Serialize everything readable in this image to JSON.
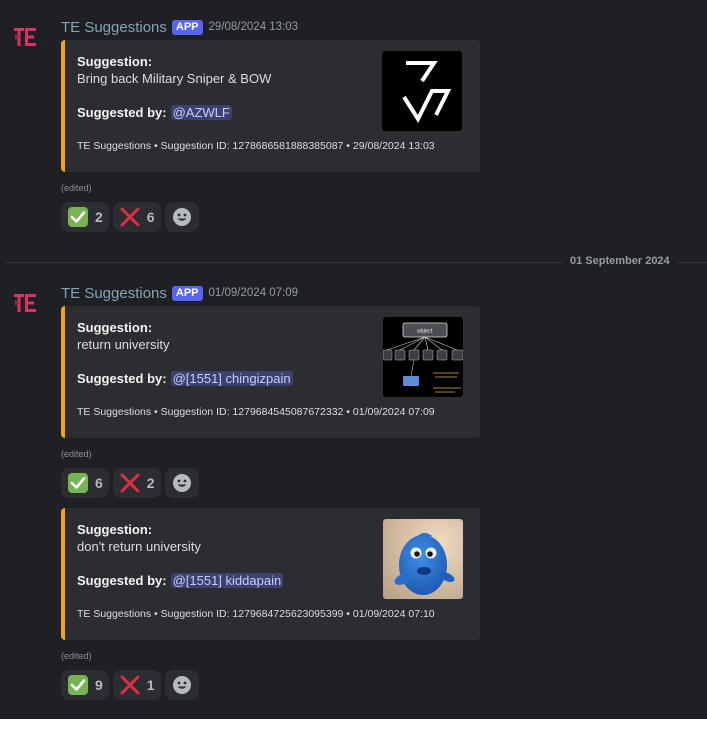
{
  "date_divider": "01 September 2024",
  "edited_label": "(edited)",
  "messages": [
    {
      "author": "TE Suggestions",
      "badge": "APP",
      "timestamp": "29/08/2024 13:03",
      "embed": {
        "suggestion_label": "Suggestion:",
        "suggestion_text": "Bring back Military Sniper & BOW",
        "suggested_by_label": "Suggested by:",
        "mention": "@AZWLF",
        "footer": "TE Suggestions • Suggestion ID: 1278686581888385087 • 29/08/2024 13:03",
        "thumbnail": "zigzag-logo"
      },
      "reactions": [
        {
          "emoji": "check-mark-icon",
          "count": "2"
        },
        {
          "emoji": "cross-mark-icon",
          "count": "6"
        }
      ]
    },
    {
      "author": "TE Suggestions",
      "badge": "APP",
      "timestamp": "01/09/2024 07:09",
      "embed": {
        "suggestion_label": "Suggestion:",
        "suggestion_text": "return university",
        "suggested_by_label": "Suggested by:",
        "mention": "@[1551] chingizpain",
        "footer": "TE Suggestions • Suggestion ID: 1279684545087672332 • 01/09/2024 07:09",
        "thumbnail": "object-diagram",
        "thumb_box_text": "object"
      },
      "reactions": [
        {
          "emoji": "check-mark-icon",
          "count": "6"
        },
        {
          "emoji": "cross-mark-icon",
          "count": "2"
        }
      ]
    },
    {
      "embed": {
        "suggestion_label": "Suggestion:",
        "suggestion_text": "don't return university",
        "suggested_by_label": "Suggested by:",
        "mention": "@[1551] kiddapain",
        "footer": "TE Suggestions • Suggestion ID: 1279684725623095399 • 01/09/2024 07:10",
        "thumbnail": "blue-fish-photo"
      },
      "reactions": [
        {
          "emoji": "check-mark-icon",
          "count": "9"
        },
        {
          "emoji": "cross-mark-icon",
          "count": "1"
        }
      ]
    }
  ],
  "colors": {
    "background": "#1f2023",
    "embed_background": "#2b2d31",
    "embed_accent": "#f0a419",
    "app_badge": "#5865f2",
    "author": "#83a4b8",
    "mention_bg": "#3c4270",
    "check": "#77b255",
    "cross": "#dd2e44",
    "avatar": "#d6336c"
  }
}
